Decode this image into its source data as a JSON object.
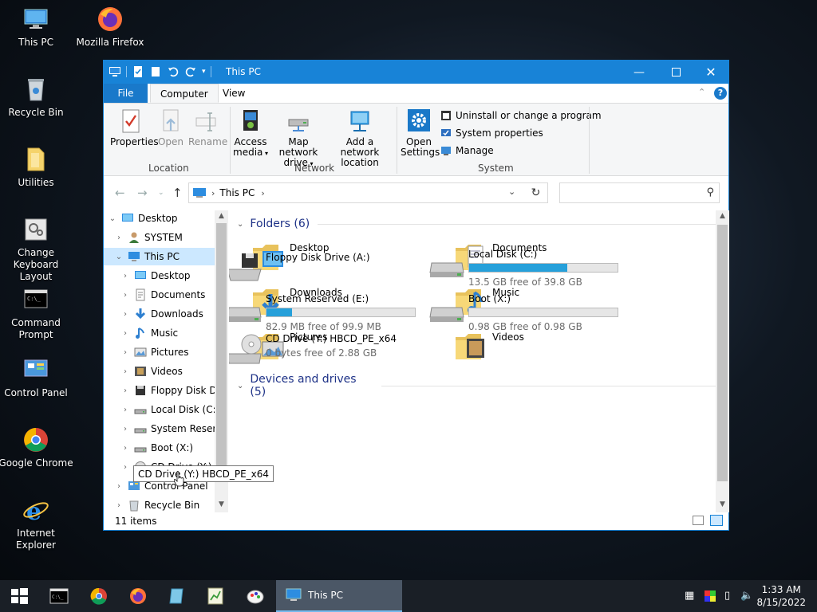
{
  "desktop": {
    "icons": [
      {
        "label": "This PC"
      },
      {
        "label": "Mozilla Firefox"
      },
      {
        "label": "Recycle Bin"
      },
      {
        "label": "Utilities"
      },
      {
        "label": "Change Keyboard Layout"
      },
      {
        "label": "Command Prompt"
      },
      {
        "label": "Control Panel"
      },
      {
        "label": "Google Chrome"
      },
      {
        "label": "Internet Explorer"
      }
    ]
  },
  "window": {
    "title": "This PC",
    "menu": {
      "file": "File",
      "computer": "Computer",
      "view": "View"
    },
    "ribbon": {
      "location": {
        "label": "Location",
        "properties": "Properties",
        "open": "Open",
        "rename": "Rename"
      },
      "network": {
        "label": "Network",
        "access_media_1": "Access",
        "access_media_2": "media",
        "map_drive_1": "Map network",
        "map_drive_2": "drive",
        "add_location_1": "Add a network",
        "add_location_2": "location"
      },
      "system": {
        "label": "System",
        "open_settings_1": "Open",
        "open_settings_2": "Settings",
        "uninstall": "Uninstall or change a program",
        "system_properties": "System properties",
        "manage": "Manage"
      }
    },
    "address": {
      "crumb": "This PC",
      "search_placeholder": ""
    },
    "nav": [
      {
        "label": "Desktop"
      },
      {
        "label": "SYSTEM"
      },
      {
        "label": "This PC"
      },
      {
        "label": "Desktop"
      },
      {
        "label": "Documents"
      },
      {
        "label": "Downloads"
      },
      {
        "label": "Music"
      },
      {
        "label": "Pictures"
      },
      {
        "label": "Videos"
      },
      {
        "label": "Floppy Disk Dri"
      },
      {
        "label": "Local Disk (C:)"
      },
      {
        "label": "System Reserve"
      },
      {
        "label": "Boot (X:)"
      },
      {
        "label": "CD Drive (Y:) HBCD_PE_x64"
      },
      {
        "label": "Control Panel"
      },
      {
        "label": "Recycle Bin"
      }
    ],
    "folders_header": "Folders (6)",
    "folders": [
      {
        "name": "Desktop"
      },
      {
        "name": "Documents"
      },
      {
        "name": "Downloads"
      },
      {
        "name": "Music"
      },
      {
        "name": "Pictures"
      },
      {
        "name": "Videos"
      }
    ],
    "drives_header": "Devices and drives (5)",
    "drives": [
      {
        "name": "Floppy Disk Drive (A:)",
        "free": "",
        "used_fraction": null
      },
      {
        "name": "Local Disk (C:)",
        "free": "13.5 GB free of 39.8 GB",
        "used_fraction": 0.66
      },
      {
        "name": "System Reserved (E:)",
        "free": "82.9 MB free of 99.9 MB",
        "used_fraction": 0.17
      },
      {
        "name": "Boot (X:)",
        "free": "0.98 GB free of 0.98 GB",
        "used_fraction": 0.0
      },
      {
        "name": "CD Drive (Y:) HBCD_PE_x64",
        "free": "0 bytes free of 2.88 GB",
        "used_fraction": null
      }
    ],
    "status": "11 items",
    "tooltip": "CD Drive (Y:) HBCD_PE_x64"
  },
  "taskbar": {
    "active_app": "This PC",
    "time": "1:33 AM",
    "date": "8/15/2022"
  },
  "colors": {
    "titlebar": "#1883d7",
    "drive_fill": "#26a0da",
    "section_header": "#1e3287",
    "selection": "#cce8ff"
  }
}
